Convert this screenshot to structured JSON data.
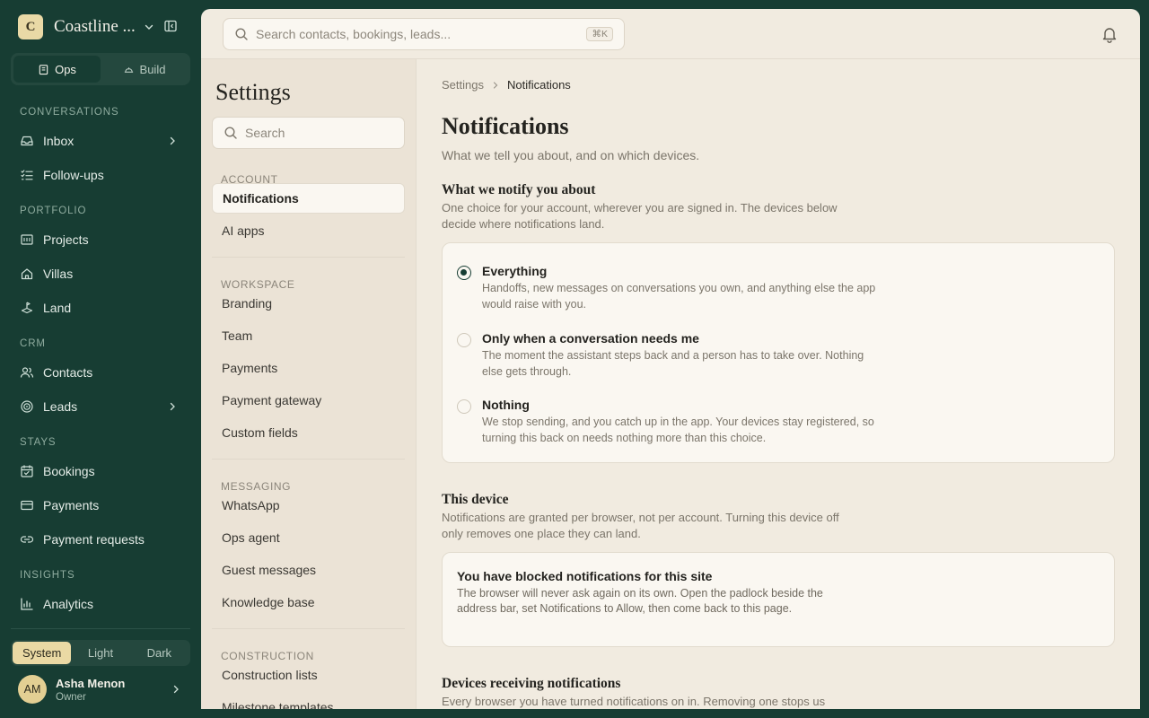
{
  "workspace": {
    "initial": "C",
    "name": "Coastline ..."
  },
  "mode_switch": {
    "ops": "Ops",
    "build": "Build",
    "active": "Ops"
  },
  "nav": {
    "sections": [
      {
        "label": "CONVERSATIONS",
        "items": [
          {
            "label": "Inbox",
            "icon": "inbox-icon",
            "has_chevron": true
          },
          {
            "label": "Follow-ups",
            "icon": "checklist-icon",
            "has_chevron": false
          }
        ]
      },
      {
        "label": "PORTFOLIO",
        "items": [
          {
            "label": "Projects",
            "icon": "building-icon",
            "has_chevron": false
          },
          {
            "label": "Villas",
            "icon": "home-icon",
            "has_chevron": false
          },
          {
            "label": "Land",
            "icon": "land-icon",
            "has_chevron": false
          }
        ]
      },
      {
        "label": "CRM",
        "items": [
          {
            "label": "Contacts",
            "icon": "users-icon",
            "has_chevron": false
          },
          {
            "label": "Leads",
            "icon": "target-icon",
            "has_chevron": true
          }
        ]
      },
      {
        "label": "STAYS",
        "items": [
          {
            "label": "Bookings",
            "icon": "calendar-icon",
            "has_chevron": false
          },
          {
            "label": "Payments",
            "icon": "card-icon",
            "has_chevron": false
          },
          {
            "label": "Payment requests",
            "icon": "link-icon",
            "has_chevron": false
          }
        ]
      },
      {
        "label": "INSIGHTS",
        "items": [
          {
            "label": "Analytics",
            "icon": "bar-chart-icon",
            "has_chevron": false
          }
        ]
      }
    ]
  },
  "theme_switch": {
    "options": [
      "System",
      "Light",
      "Dark"
    ],
    "active": "System"
  },
  "user": {
    "initials": "AM",
    "name": "Asha Menon",
    "role": "Owner"
  },
  "topbar": {
    "search_placeholder": "Search contacts, bookings, leads...",
    "shortcut": "⌘K"
  },
  "settings_nav": {
    "title": "Settings",
    "search_placeholder": "Search",
    "sections": [
      {
        "label": "ACCOUNT",
        "items": [
          "Notifications",
          "AI apps"
        ]
      },
      {
        "label": "WORKSPACE",
        "items": [
          "Branding",
          "Team",
          "Payments",
          "Payment gateway",
          "Custom fields"
        ]
      },
      {
        "label": "MESSAGING",
        "items": [
          "WhatsApp",
          "Ops agent",
          "Guest messages",
          "Knowledge base"
        ]
      },
      {
        "label": "CONSTRUCTION",
        "items": [
          "Construction lists",
          "Milestone templates"
        ]
      }
    ],
    "active": "Notifications"
  },
  "page": {
    "breadcrumb": {
      "parent": "Settings",
      "current": "Notifications"
    },
    "title": "Notifications",
    "subtitle": "What we tell you about, and on which devices.",
    "notify_section": {
      "title": "What we notify you about",
      "description": "One choice for your account, wherever you are signed in. The devices below decide where notifications land.",
      "selected": "Everything",
      "options": [
        {
          "label": "Everything",
          "description": "Handoffs, new messages on conversations you own, and anything else the app would raise with you."
        },
        {
          "label": "Only when a conversation needs me",
          "description": "The moment the assistant steps back and a person has to take over. Nothing else gets through."
        },
        {
          "label": "Nothing",
          "description": "We stop sending, and you catch up in the app. Your devices stay registered, so turning this back on needs nothing more than this choice."
        }
      ]
    },
    "device_section": {
      "title": "This device",
      "description": "Notifications are granted per browser, not per account. Turning this device off only removes one place they can land.",
      "alert_title": "You have blocked notifications for this site",
      "alert_description": "The browser will never ask again on its own. Open the padlock beside the address bar, set Notifications to Allow, then come back to this page."
    },
    "devices_section": {
      "title": "Devices receiving notifications",
      "description": "Every browser you have turned notifications on in. Removing one stops us"
    }
  }
}
